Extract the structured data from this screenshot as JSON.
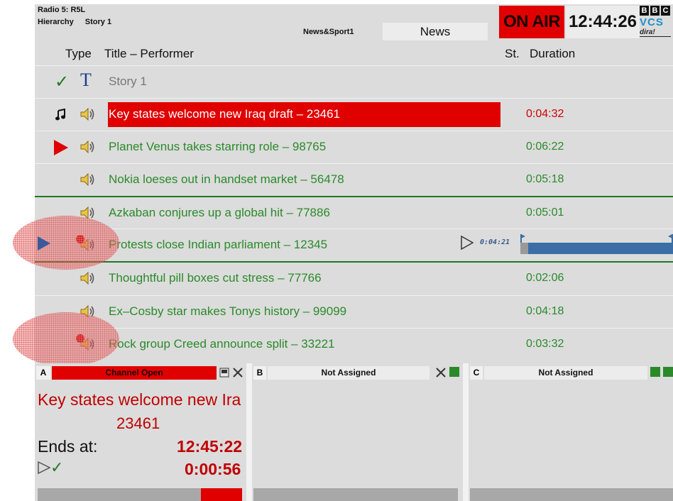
{
  "header": {
    "station": "Radio 5: R5L",
    "hierarchy_label": "Hierarchy",
    "hierarchy_value": "Story 1",
    "section": "News&Sport1",
    "news_button": "News",
    "on_air": "ON AIR",
    "clock": "12:44:26",
    "logo": {
      "letters": [
        "B",
        "B",
        "C"
      ],
      "vcs": "VCS",
      "dira": "dira!"
    }
  },
  "columns": {
    "type": "Type",
    "title": "Title – Performer",
    "status": "St.",
    "duration": "Duration"
  },
  "story": {
    "title": "Story 1",
    "type_glyph": "T",
    "check_glyph": "✓"
  },
  "rows": [
    {
      "title": "Key states welcome new Iraq draft – 23461",
      "duration": "0:04:32",
      "state": "playing"
    },
    {
      "title": "Planet Venus takes starring role – 98765",
      "duration": "0:06:22",
      "state": "next"
    },
    {
      "title": "Nokia loeses out in handset market – 56478",
      "duration": "0:05:18",
      "state": "normal"
    },
    {
      "title": "Azkaban conjures up a global hit – 77886",
      "duration": "0:05:01",
      "state": "normal"
    },
    {
      "title": "Protests close Indian parliament – 12345",
      "duration": "",
      "state": "preview"
    },
    {
      "title": "Thoughtful pill boxes cut stress – 77766",
      "duration": "0:02:06",
      "state": "normal"
    },
    {
      "title": "Ex–Cosby star makes Tonys history – 99099",
      "duration": "0:04:18",
      "state": "normal"
    },
    {
      "title": "Rock group Creed announce split – 33221",
      "duration": "0:03:32",
      "state": "flagged"
    }
  ],
  "preview": {
    "time": "0:04:21",
    "progress": 0.05
  },
  "channels": {
    "a": {
      "letter": "A",
      "status": "Channel Open",
      "title_line1": "Key states welcome new Ira",
      "title_line2": "23461",
      "ends_label": "Ends at:",
      "ends_time": "12:45:22",
      "remaining": "0:00:56",
      "progress": 0.8
    },
    "b": {
      "letter": "B",
      "status": "Not Assigned"
    },
    "c": {
      "letter": "C",
      "status": "Not Assigned"
    }
  },
  "colors": {
    "red": "#e00000",
    "green_text": "#2a8a2a",
    "panel": "#dcdcdc",
    "progress_blue": "#3a6ea5"
  },
  "icons": [
    "check-icon",
    "text-type-icon",
    "music-note-icon",
    "speaker-icon",
    "play-triangle-icon",
    "close-icon",
    "window-icon",
    "eject-icon"
  ]
}
